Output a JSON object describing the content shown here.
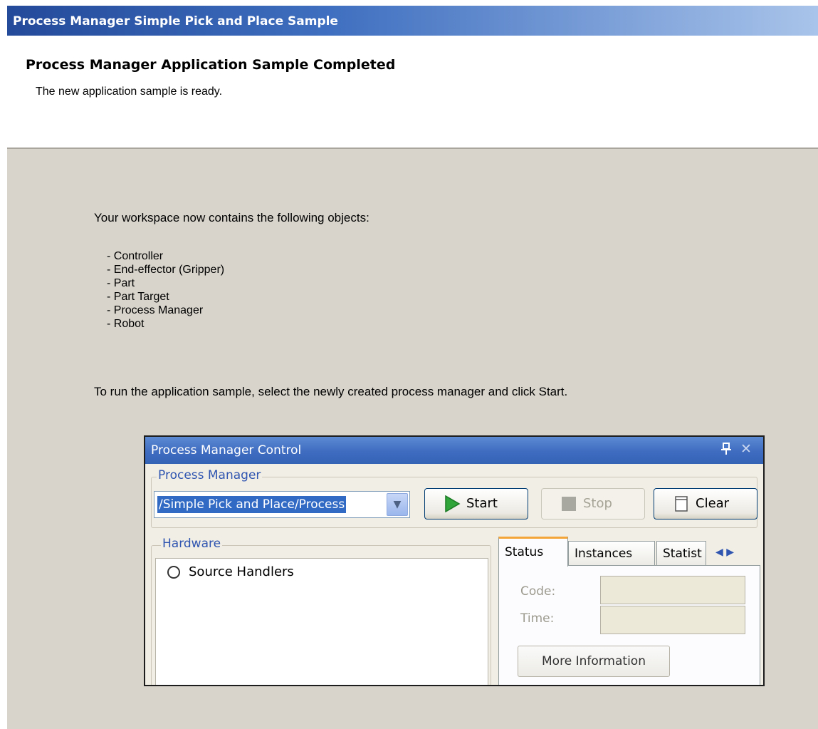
{
  "window": {
    "title": "Process Manager Simple Pick and Place Sample"
  },
  "header": {
    "title": "Process Manager Application Sample Completed",
    "subtitle": "The new application sample is ready."
  },
  "body": {
    "intro": "Your workspace now contains the following objects:",
    "objects": [
      "- Controller",
      "- End-effector (Gripper)",
      "- Part",
      "- Part Target",
      "- Process Manager",
      "- Robot"
    ],
    "run_instructions": "To run the application sample, select the newly created process manager and click Start."
  },
  "pm_control": {
    "title": "Process Manager Control",
    "pin_icon": "pin-icon",
    "close_icon": "close-icon",
    "group_label": "Process Manager",
    "selected_process": "/Simple Pick and Place/Process",
    "buttons": {
      "start": "Start",
      "stop": "Stop",
      "clear": "Clear"
    },
    "hardware_label": "Hardware",
    "hardware_items": [
      "Source Handlers"
    ],
    "tabs": [
      "Status",
      "Instances",
      "Statist"
    ],
    "active_tab": "Status",
    "fields": {
      "code_label": "Code:",
      "time_label": "Time:"
    },
    "more_info": "More Information"
  },
  "colors": {
    "title_bar": "#244a9a",
    "dialog_background": "#d8d4cc",
    "group_label": "#2f55b0",
    "start_icon": "#2fa53a",
    "active_tab_accent": "#f3a53a"
  }
}
